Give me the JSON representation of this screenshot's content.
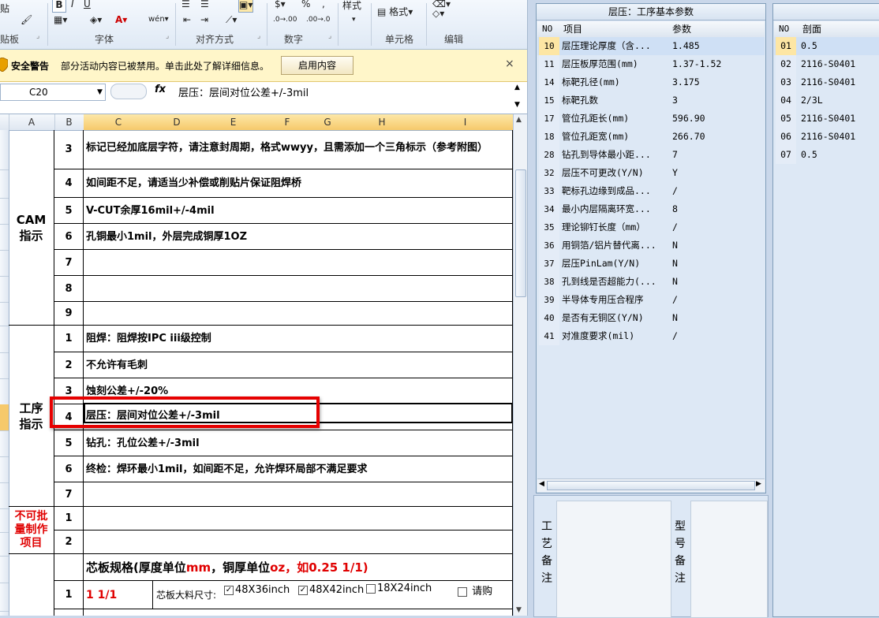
{
  "ribbon": {
    "paste_label": "贴",
    "groups": {
      "clipboard": "贴板",
      "font": "字体",
      "alignment": "对齐方式",
      "number": "数字",
      "cells": "单元格",
      "editing": "编辑"
    },
    "styles_label": "样式",
    "format_label": "格式"
  },
  "security_bar": {
    "title": "安全警告",
    "message": "部分活动内容已被禁用。单击此处了解详细信息。",
    "enable_button": "启用内容",
    "close": "×"
  },
  "formula_bar": {
    "name_box": "C20",
    "fx": "fx",
    "content": "层压：层间对位公差+/-3mil"
  },
  "columns": [
    "A",
    "B",
    "C",
    "D",
    "E",
    "F",
    "G",
    "H",
    "I"
  ],
  "sheet": {
    "groups": [
      {
        "label": "CAM\n指示"
      },
      {
        "label": "工序\n指示"
      },
      {
        "label": "不可批\n量制作\n项目"
      }
    ],
    "cam_rows": [
      {
        "no": "3",
        "text": "标记已经加底层字符，请注意封周期，格式wwyy，且需添加一个三角标示（参考附图）"
      },
      {
        "no": "4",
        "text": "如间距不足，请适当少补偿或削贴片保证阻焊桥"
      },
      {
        "no": "5",
        "text": "V-CUT余厚16mil+/-4mil"
      },
      {
        "no": "6",
        "text": "孔铜最小1mil，外层完成铜厚1OZ"
      },
      {
        "no": "7",
        "text": ""
      },
      {
        "no": "8",
        "text": ""
      },
      {
        "no": "9",
        "text": ""
      }
    ],
    "process_rows": [
      {
        "no": "1",
        "text": "阻焊：阻焊按IPC iii级控制"
      },
      {
        "no": "2",
        "text": "不允许有毛刺"
      },
      {
        "no": "3",
        "text": "蚀刻公差+/-20%"
      },
      {
        "no": "4",
        "text": "层压：层间对位公差+/-3mil"
      },
      {
        "no": "5",
        "text": "钻孔：孔位公差+/-3mil"
      },
      {
        "no": "6",
        "text": "终检：焊环最小1mil，如间距不足，允许焊环局部不满足要求"
      },
      {
        "no": "7",
        "text": ""
      }
    ],
    "nonbatch_rows": [
      {
        "no": "1",
        "text": ""
      },
      {
        "no": "2",
        "text": ""
      }
    ],
    "core_spec": {
      "title_a": "芯板规格(厚度单位",
      "unit_mm": "mm",
      "title_b": "，铜厚单位",
      "unit_oz": "oz",
      "title_c": "，如0.25 1/1)",
      "row_no": "1",
      "row_value": "1 1/1",
      "size_label": "芯板大料尺寸:",
      "options": [
        {
          "label": "48X36inch",
          "checked": true
        },
        {
          "label": "48X42inch",
          "checked": false
        },
        {
          "label": "18X24inch",
          "checked": false
        }
      ],
      "purchase_label": "请购"
    }
  },
  "panel1": {
    "title": "层压：工序基本参数",
    "headers": {
      "no": "NO",
      "item": "项目",
      "value": "参数"
    },
    "rows": [
      {
        "no": "10",
        "item": "层压理论厚度（含...",
        "value": "1.485"
      },
      {
        "no": "11",
        "item": "层压板厚范围(mm)",
        "value": "1.37-1.52"
      },
      {
        "no": "14",
        "item": "标靶孔径(mm)",
        "value": "3.175"
      },
      {
        "no": "15",
        "item": "标靶孔数",
        "value": "3"
      },
      {
        "no": "17",
        "item": "管位孔距长(mm)",
        "value": "596.90"
      },
      {
        "no": "18",
        "item": "管位孔距宽(mm)",
        "value": "266.70"
      },
      {
        "no": "28",
        "item": "钻孔到导体最小距...",
        "value": "7"
      },
      {
        "no": "32",
        "item": "层压不可更改(Y/N)",
        "value": "Y"
      },
      {
        "no": "33",
        "item": "靶标孔边缘到成品...",
        "value": "/"
      },
      {
        "no": "34",
        "item": "最小内层隔离环宽...",
        "value": "8"
      },
      {
        "no": "35",
        "item": "理论铆钉长度（mm）",
        "value": "/"
      },
      {
        "no": "36",
        "item": "用铜箔/铝片替代离...",
        "value": "N"
      },
      {
        "no": "37",
        "item": "层压PinLam(Y/N)",
        "value": "N"
      },
      {
        "no": "38",
        "item": "孔到线是否超能力(...",
        "value": "N"
      },
      {
        "no": "39",
        "item": "半导体专用压合程序",
        "value": "/"
      },
      {
        "no": "40",
        "item": "是否有无铜区(Y/N)",
        "value": "N"
      },
      {
        "no": "41",
        "item": "对准度要求(mil)",
        "value": "/"
      }
    ]
  },
  "panel2": {
    "headers": {
      "no": "NO",
      "value": "剖面"
    },
    "rows": [
      {
        "no": "01",
        "value": "0.5"
      },
      {
        "no": "02",
        "value": "2116-S0401"
      },
      {
        "no": "03",
        "value": "2116-S0401"
      },
      {
        "no": "04",
        "value": "2/3L"
      },
      {
        "no": "05",
        "value": "2116-S0401"
      },
      {
        "no": "06",
        "value": "2116-S0401"
      },
      {
        "no": "07",
        "value": "0.5"
      }
    ]
  },
  "notes": {
    "process_note_label": "工艺备注",
    "model_note_label": "型号备注"
  },
  "colors": {
    "highlight": "#e60000",
    "accent_red": "#e00000",
    "warn_bg": "#fff6c9"
  }
}
